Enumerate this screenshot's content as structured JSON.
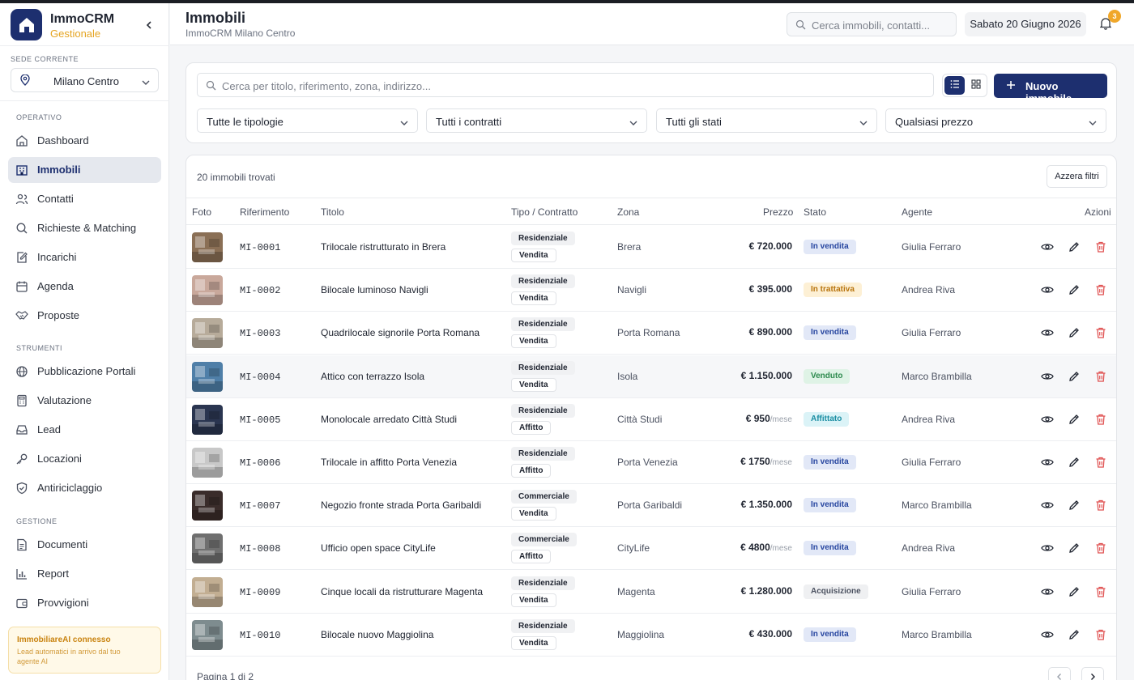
{
  "brand": {
    "name": "ImmoCRM",
    "subtitle": "Gestionale"
  },
  "sede": {
    "label": "SEDE CORRENTE",
    "value": "Milano Centro"
  },
  "nav": {
    "operativo_label": "OPERATIVO",
    "strumenti_label": "STRUMENTI",
    "gestione_label": "GESTIONE",
    "items": {
      "dashboard": "Dashboard",
      "immobili": "Immobili",
      "contatti": "Contatti",
      "richieste": "Richieste & Matching",
      "incarichi": "Incarichi",
      "agenda": "Agenda",
      "proposte": "Proposte",
      "portali": "Pubblicazione Portali",
      "valutazione": "Valutazione",
      "lead": "Lead",
      "locazioni": "Locazioni",
      "antiriciclaggio": "Antiriciclaggio",
      "documenti": "Documenti",
      "report": "Report",
      "provvigioni": "Provvigioni"
    },
    "active": "immobili"
  },
  "ai_banner": {
    "title": "ImmobiliareAI connesso",
    "text": "Lead automatici in arrivo dal tuo agente AI"
  },
  "header": {
    "title": "Immobili",
    "subtitle": "ImmoCRM Milano Centro",
    "search_placeholder": "Cerca immobili, contatti...",
    "date": "Sabato 20 Giugno 2026",
    "notifications": "3"
  },
  "filters": {
    "search_placeholder": "Cerca per titolo, riferimento, zona, indirizzo...",
    "new_button": "Nuovo immobile",
    "tipologie": "Tutte le tipologie",
    "contratti": "Tutti i contratti",
    "stati": "Tutti gli stati",
    "prezzo": "Qualsiasi prezzo"
  },
  "table": {
    "found": "20 immobili trovati",
    "reset": "Azzera filtri",
    "headers": {
      "foto": "Foto",
      "riferimento": "Riferimento",
      "titolo": "Titolo",
      "tipo": "Tipo / Contratto",
      "zona": "Zona",
      "prezzo": "Prezzo",
      "stato": "Stato",
      "agente": "Agente",
      "azioni": "Azioni"
    },
    "rows": [
      {
        "ref": "MI-0001",
        "title": "Trilocale ristrutturato in Brera",
        "type": "Residenziale",
        "contract": "Vendita",
        "zona": "Brera",
        "price": "€ 720.000",
        "unit": "",
        "status": "In vendita",
        "status_tone": "blue",
        "agent": "Giulia Ferraro",
        "thumb_color": "#8a6f55"
      },
      {
        "ref": "MI-0002",
        "title": "Bilocale luminoso Navigli",
        "type": "Residenziale",
        "contract": "Vendita",
        "zona": "Navigli",
        "price": "€ 395.000",
        "unit": "",
        "status": "In trattativa",
        "status_tone": "amber",
        "agent": "Andrea Riva",
        "thumb_color": "#c9a89b"
      },
      {
        "ref": "MI-0003",
        "title": "Quadrilocale signorile Porta Romana",
        "type": "Residenziale",
        "contract": "Vendita",
        "zona": "Porta Romana",
        "price": "€ 890.000",
        "unit": "",
        "status": "In vendita",
        "status_tone": "blue",
        "agent": "Giulia Ferraro",
        "thumb_color": "#b7ab9a"
      },
      {
        "ref": "MI-0004",
        "title": "Attico con terrazzo Isola",
        "type": "Residenziale",
        "contract": "Vendita",
        "zona": "Isola",
        "price": "€ 1.150.000",
        "unit": "",
        "status": "Venduto",
        "status_tone": "green",
        "agent": "Marco Brambilla",
        "thumb_color": "#4f7fa8"
      },
      {
        "ref": "MI-0005",
        "title": "Monolocale arredato Città Studi",
        "type": "Residenziale",
        "contract": "Affitto",
        "zona": "Città Studi",
        "price": "€ 950",
        "unit": "/mese",
        "status": "Affittato",
        "status_tone": "cyan",
        "agent": "Andrea Riva",
        "thumb_color": "#2a3550"
      },
      {
        "ref": "MI-0006",
        "title": "Trilocale in affitto Porta Venezia",
        "type": "Residenziale",
        "contract": "Affitto",
        "zona": "Porta Venezia",
        "price": "€ 1750",
        "unit": "/mese",
        "status": "In vendita",
        "status_tone": "blue",
        "agent": "Giulia Ferraro",
        "thumb_color": "#c8c8c8"
      },
      {
        "ref": "MI-0007",
        "title": "Negozio fronte strada Porta Garibaldi",
        "type": "Commerciale",
        "contract": "Vendita",
        "zona": "Porta Garibaldi",
        "price": "€ 1.350.000",
        "unit": "",
        "status": "In vendita",
        "status_tone": "blue",
        "agent": "Marco Brambilla",
        "thumb_color": "#3a2c2a"
      },
      {
        "ref": "MI-0008",
        "title": "Ufficio open space CityLife",
        "type": "Commerciale",
        "contract": "Affitto",
        "zona": "CityLife",
        "price": "€ 4800",
        "unit": "/mese",
        "status": "In vendita",
        "status_tone": "blue",
        "agent": "Andrea Riva",
        "thumb_color": "#6f6f6f"
      },
      {
        "ref": "MI-0009",
        "title": "Cinque locali da ristrutturare Magenta",
        "type": "Residenziale",
        "contract": "Vendita",
        "zona": "Magenta",
        "price": "€ 1.280.000",
        "unit": "",
        "status": "Acquisizione",
        "status_tone": "gray",
        "agent": "Giulia Ferraro",
        "thumb_color": "#c2ae92"
      },
      {
        "ref": "MI-0010",
        "title": "Bilocale nuovo Maggiolina",
        "type": "Residenziale",
        "contract": "Vendita",
        "zona": "Maggiolina",
        "price": "€ 430.000",
        "unit": "",
        "status": "In vendita",
        "status_tone": "blue",
        "agent": "Marco Brambilla",
        "thumb_color": "#7e8c8f"
      }
    ],
    "pager": "Pagina 1 di 2"
  }
}
